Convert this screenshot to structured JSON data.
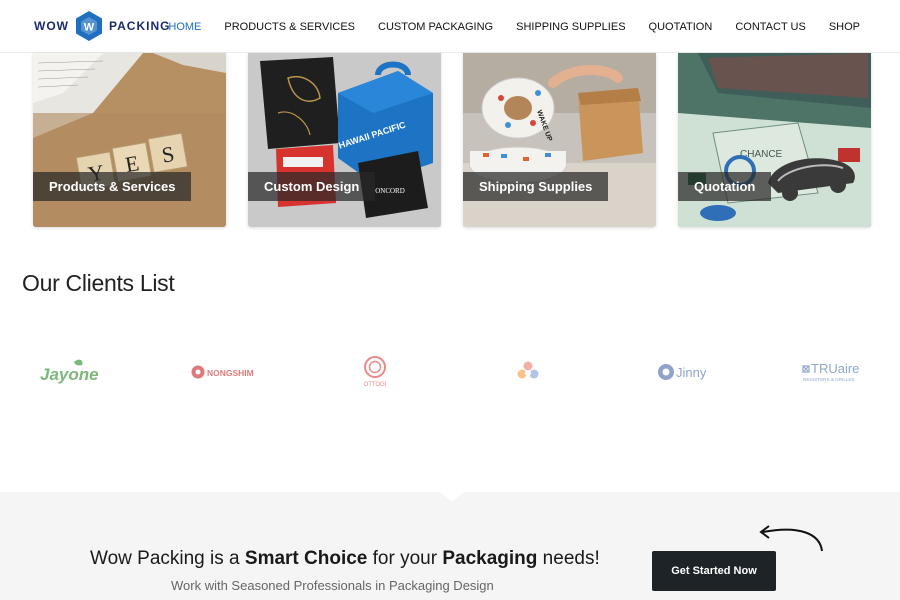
{
  "brand": {
    "left": "WOW",
    "mark": "W",
    "right": "PACKING",
    "color": "#1a2a6c",
    "accent": "#1e6fbf"
  },
  "nav": [
    {
      "label": "HOME",
      "active": true
    },
    {
      "label": "PRODUCTS & SERVICES",
      "active": false
    },
    {
      "label": "CUSTOM PACKAGING",
      "active": false
    },
    {
      "label": "SHIPPING SUPPLIES",
      "active": false
    },
    {
      "label": "QUOTATION",
      "active": false
    },
    {
      "label": "CONTACT US",
      "active": false
    },
    {
      "label": "SHOP",
      "active": false
    }
  ],
  "cards": [
    {
      "caption": "Products & Services",
      "tiles": [
        "Y",
        "E",
        "S"
      ]
    },
    {
      "caption": "Custom Design",
      "box_text": "HAWAII PACIFIC",
      "tag_text": "ONCORD"
    },
    {
      "caption": "Shipping Supplies",
      "tape_text": "WAKE UP"
    },
    {
      "caption": "Quotation",
      "board_text": "CHANCE"
    }
  ],
  "clients": {
    "title": "Our Clients List",
    "logos": [
      {
        "text": "Jayone",
        "color": "#7cb87a"
      },
      {
        "text": "NONGSHIM",
        "color": "#e07a7a"
      },
      {
        "text": "OTTOGI",
        "color": "#e88a8a"
      },
      {
        "text": "",
        "color": "#e9a5a5"
      },
      {
        "text": "Jinny",
        "color": "#8fa3c9"
      },
      {
        "text": "TRUaire",
        "sub": "REGISTERS & GRILLES",
        "color": "#8fa8c9"
      }
    ]
  },
  "cta": {
    "pre": "Wow Packing is a ",
    "bold1": "Smart Choice",
    "mid": " for your ",
    "bold2": "Packaging",
    "post": " needs!",
    "subtitle": "Work with Seasoned Professionals in Packaging Design",
    "button": "Get Started Now"
  }
}
